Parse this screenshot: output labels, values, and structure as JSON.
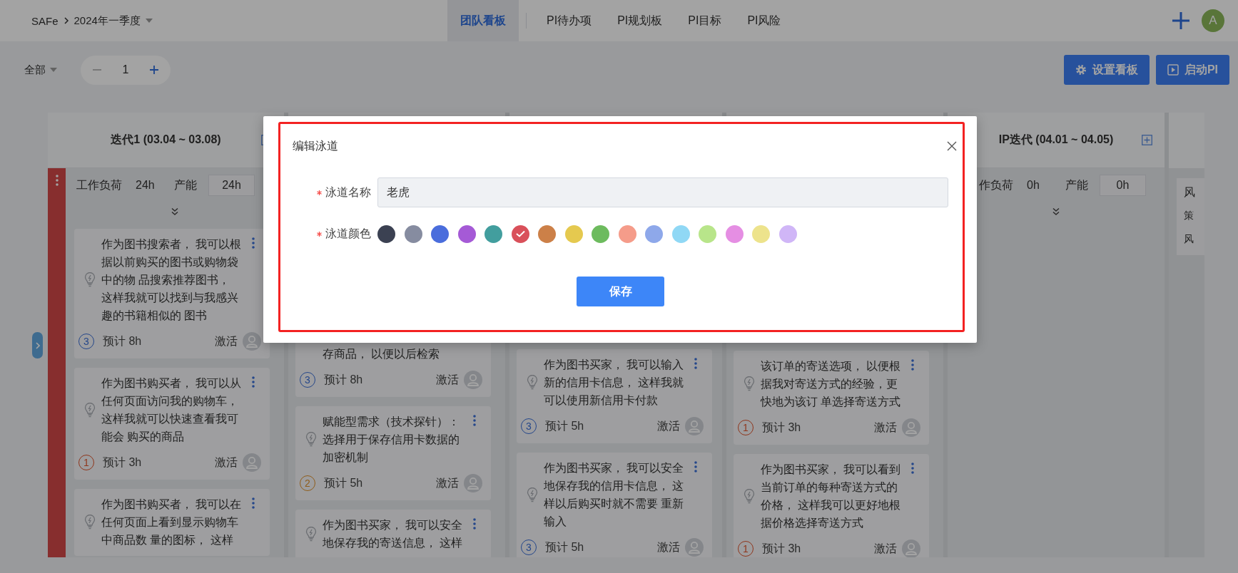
{
  "top_bar": {
    "breadcrumb": [
      "SAFe",
      "2024年一季度"
    ],
    "tabs": [
      {
        "label": "团队看板",
        "selected": true
      },
      {
        "label": "PI待办项",
        "selected": false
      },
      {
        "label": "PI规划板",
        "selected": false
      },
      {
        "label": "PI目标",
        "selected": false
      },
      {
        "label": "PI风险",
        "selected": false
      }
    ],
    "avatar": "A"
  },
  "toolbar": {
    "filter": "全部",
    "stepper_value": "1",
    "buttons": [
      {
        "label": "设置看板"
      },
      {
        "label": "启动PI"
      }
    ]
  },
  "board": {
    "columns": [
      {
        "title": "迭代1 (03.04 ~ 03.08)",
        "stats": {
          "workload_label": "工作负荷",
          "workload": "24h",
          "capacity_label": "产能",
          "capacity": "24h"
        },
        "cards": [
          {
            "kind": "full",
            "lines": [
              "作为图书搜索者， 我可以根",
              "据以前购买的图书或购物袋",
              "中的物 品搜索推荐图书，",
              "这样我就可以找到与我感兴",
              "趣的书籍相似的 图书"
            ],
            "points": "3",
            "color": "#25478a",
            "estimate": "预计 8h",
            "status": "激活"
          },
          {
            "kind": "full",
            "lines": [
              "作为图书购买者， 我可以从",
              "任何页面访问我的购物车，",
              "这样我就可以快速查看我可",
              "能会 购买的商品"
            ],
            "points": "1",
            "color": "#8f361c",
            "estimate": "预计 3h",
            "status": "激活"
          },
          {
            "kind": "full",
            "lines": [
              "作为图书购买者， 我可以在",
              "任何页面上看到显示购物车",
              "中商品数 量的图标， 这样"
            ]
          }
        ]
      },
      {
        "cards": [
          {
            "kind": "partial",
            "lines": [
              "存商品， 以便以后检索"
            ],
            "points": "3",
            "color": "#25478a",
            "estimate": "预计 8h",
            "status": "激活"
          },
          {
            "kind": "full",
            "lines": [
              "赋能型需求（技术探针）：",
              "选择用于保存信用卡数据的",
              "加密机制"
            ],
            "points": "2",
            "color": "#8f5d1b",
            "estimate": "预计 5h",
            "status": "激活"
          },
          {
            "kind": "full",
            "lines": [
              "作为图书买家， 我可以安全",
              "地保存我的寄送信息， 这样"
            ]
          }
        ]
      },
      {
        "cards": [
          {
            "kind": "full",
            "lines": [
              "作为图书买家， 我可以输入",
              "新的信用卡信息， 这样我就",
              "可以使用新信用卡付款"
            ],
            "points": "3",
            "color": "#25478a",
            "estimate": "预计 5h",
            "status": "激活"
          },
          {
            "kind": "full",
            "lines": [
              "作为图书买家， 我可以安全",
              "地保存我的信用卡信息， 这",
              "样以后购买时就不需要 重新",
              "输入"
            ],
            "points": "3",
            "color": "#25478a",
            "estimate": "预计 5h",
            "status": "激活"
          }
        ]
      },
      {
        "cards": [
          {
            "kind": "full",
            "lines": [
              "该订单的寄送选项， 以便根",
              "据我对寄送方式的经验，更",
              "快地为该订 单选择寄送方式"
            ],
            "points": "1",
            "color": "#8f361c",
            "estimate": "预计 3h",
            "status": "激活"
          },
          {
            "kind": "full",
            "lines": [
              "作为图书买家， 我可以看到",
              "当前订单的每种寄送方式的",
              "价格， 这样我可以更好地根",
              "据价格选择寄送方式"
            ],
            "points": "1",
            "color": "#8f361c",
            "estimate": "预计 3h",
            "status": "激活"
          }
        ]
      },
      {
        "title": "IP迭代 (04.01 ~ 04.05)",
        "stats": {
          "workload_label": "作负荷",
          "workload": "0h",
          "capacity_label": "产能",
          "capacity": "0h"
        }
      }
    ],
    "risk_panel": {
      "items": [
        "风",
        "策",
        "风"
      ]
    }
  },
  "dialog": {
    "title": "编辑泳道",
    "name_field": {
      "label": "泳道名称",
      "required": true,
      "value": "老虎"
    },
    "color_field": {
      "label": "泳道颜色",
      "required": true,
      "swatches": [
        {
          "color": "#3b4152",
          "selected": false
        },
        {
          "color": "#868ca0",
          "selected": false
        },
        {
          "color": "#4a6ddc",
          "selected": false
        },
        {
          "color": "#a55ad6",
          "selected": false
        },
        {
          "color": "#429e9e",
          "selected": false
        },
        {
          "color": "#d9505a",
          "selected": true
        },
        {
          "color": "#cc8048",
          "selected": false
        },
        {
          "color": "#e5c94f",
          "selected": false
        },
        {
          "color": "#6dbb5e",
          "selected": false
        },
        {
          "color": "#f59c8a",
          "selected": false
        },
        {
          "color": "#8ea8ea",
          "selected": false
        },
        {
          "color": "#90d8f5",
          "selected": false
        },
        {
          "color": "#b8e58a",
          "selected": false
        },
        {
          "color": "#e58ee3",
          "selected": false
        },
        {
          "color": "#ede38c",
          "selected": false
        },
        {
          "color": "#d0b6f7",
          "selected": false
        }
      ]
    },
    "save_button": "保存"
  }
}
